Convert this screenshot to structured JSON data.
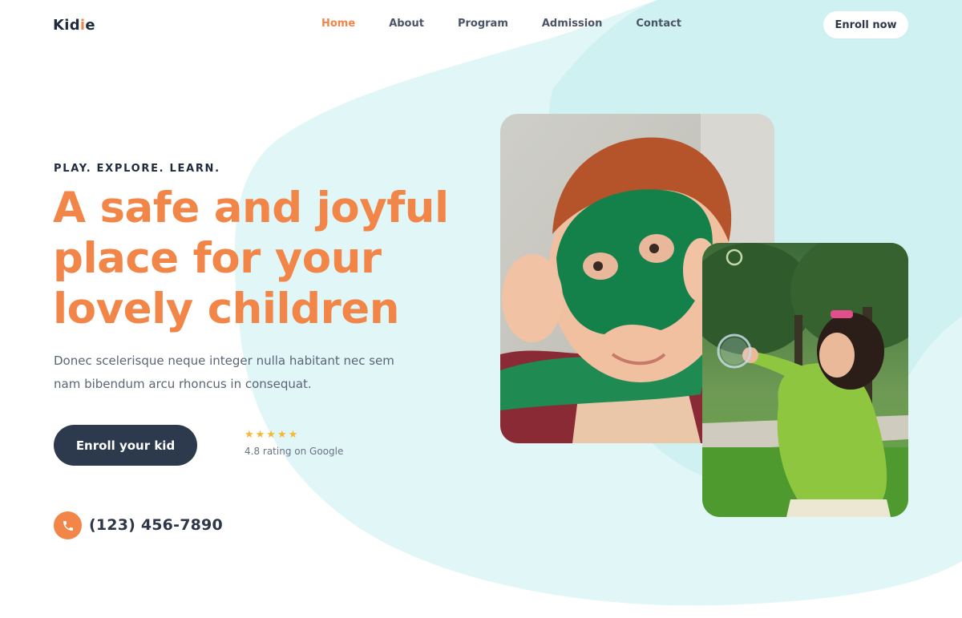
{
  "header": {
    "logo": {
      "part1": "Kid",
      "part2": "i",
      "part3": "e"
    },
    "nav": [
      {
        "label": "Home",
        "active": true
      },
      {
        "label": "About",
        "active": false
      },
      {
        "label": "Program",
        "active": false
      },
      {
        "label": "Admission",
        "active": false
      },
      {
        "label": "Contact",
        "active": false
      }
    ],
    "enroll_now_label": "Enroll now"
  },
  "hero": {
    "eyebrow": "PLAY. EXPLORE. LEARN.",
    "headline_lines": [
      "A safe and joyful",
      "place for your",
      "lovely children"
    ],
    "description": "Donec scelerisque neque integer nulla habitant nec sem nam bibendum arcu rhoncus in consequat.",
    "cta_label": "Enroll your kid",
    "rating": {
      "stars": "★★★★★",
      "text": "4.8 rating on Google"
    },
    "phone": "(123) 456-7890",
    "phone_icon": "phone-icon"
  },
  "images": {
    "photo_1": "boy-in-green-mask-photo",
    "photo_2": "girl-with-soap-bubbles-photo"
  },
  "colors": {
    "accent": "#f28548",
    "dark": "#2d3a4e",
    "blob": "#dff6f7",
    "stars": "#f6b637"
  }
}
